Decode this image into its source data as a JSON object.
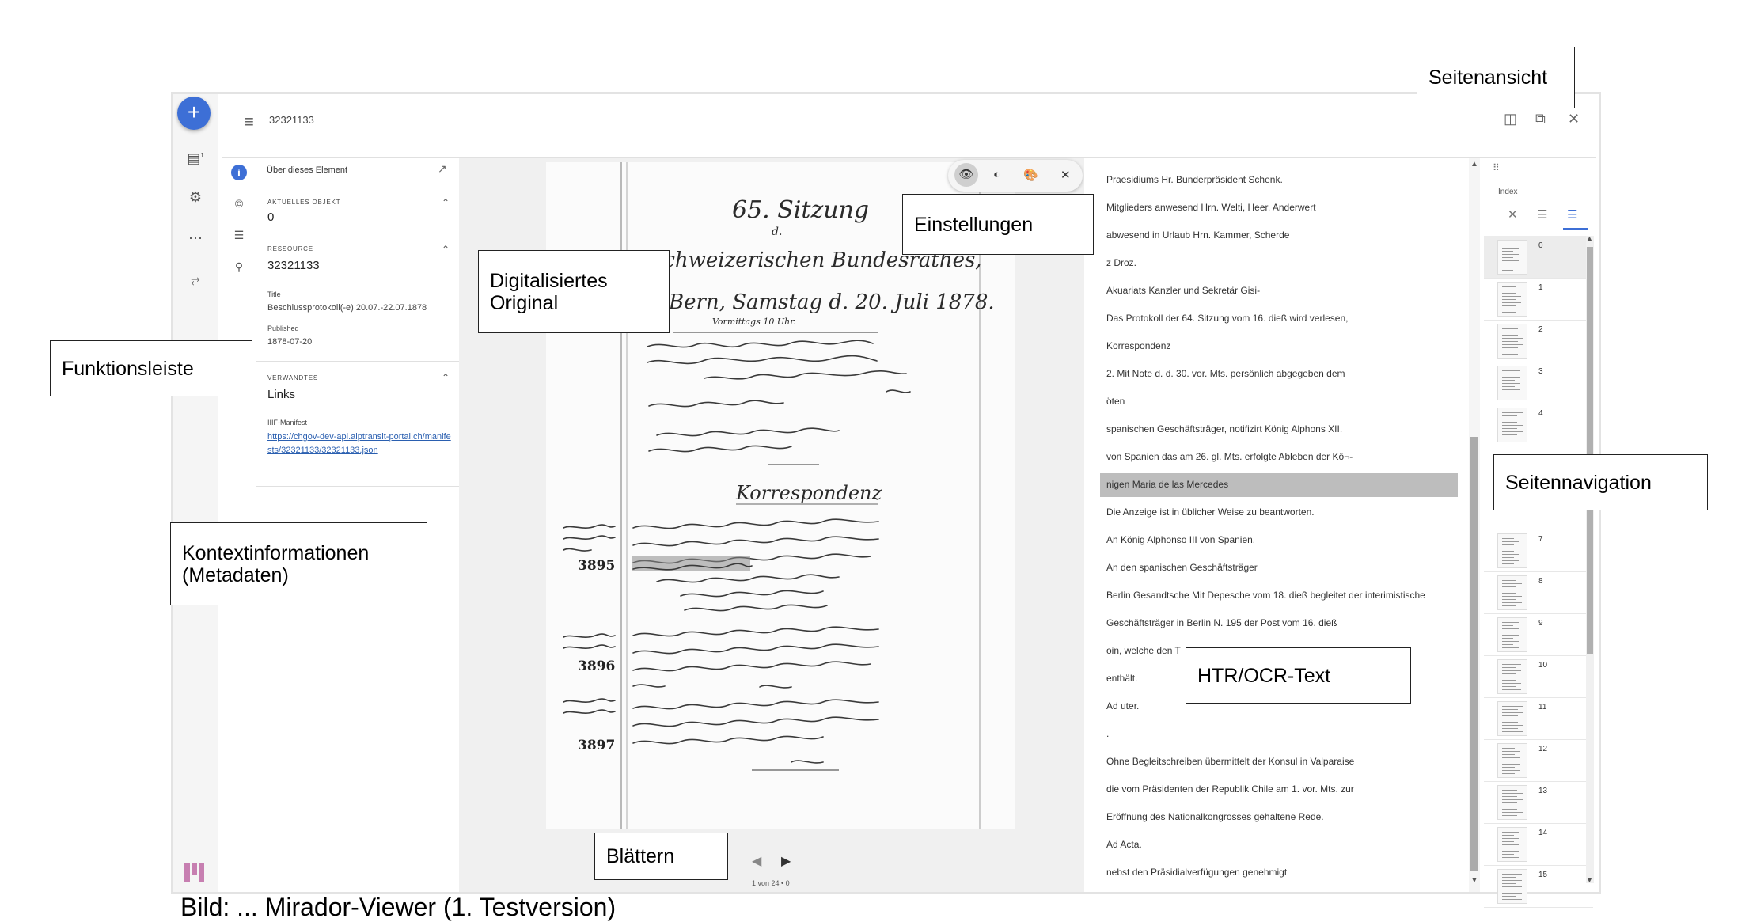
{
  "topbar": {
    "object_id": "32321133",
    "menu_icon": "hamburger-icon",
    "right_icons": [
      "split-view-icon",
      "fullscreen-icon",
      "close-icon"
    ],
    "close_glyph": "✕"
  },
  "leftbar": {
    "add_glyph": "+",
    "icons": [
      "catalog-icon",
      "settings-icon",
      "more-icon",
      "drag-icon"
    ],
    "catalog_badge": "1"
  },
  "sidenav": {
    "icons": [
      "info-icon",
      "copyright-icon",
      "toc-icon",
      "search-icon"
    ]
  },
  "metadata": {
    "header": "Über dieses Element",
    "current_object_caption": "AKTUELLES OBJEKT",
    "current_object_value": "0",
    "resource_caption": "RESSOURCE",
    "resource_value": "32321133",
    "title_caption": "Title",
    "title_value": "Beschlussprotokoll(-e) 20.07.-22.07.1878",
    "published_caption": "Published",
    "published_value": "1878-07-20",
    "related_caption": "VERWANDTES",
    "related_value": "Links",
    "iiif_caption": "IIIF-Manifest",
    "iiif_link": "https://chgov-dev-api.alptransit-portal.ch/manifests/32321133/32321133.json"
  },
  "viewer": {
    "tools": [
      "eye-icon",
      "contrast-icon",
      "palette-icon",
      "close-icon"
    ],
    "page_label": "1 von 24 • 0",
    "doc": {
      "title_line1": "65. Sitzung",
      "title_line2": "d.",
      "title_line3": "schweizerischen Bundesrathes,",
      "title_line4": "Bern, Samstag d. 20. Juli 1878.",
      "title_line5": "Vormittags 10 Uhr.",
      "heading": "Korrespondenz",
      "num1": "3895",
      "num2": "3896",
      "num3": "3897"
    }
  },
  "text_lines": [
    "Praesidiums Hr. Bunderpräsident Schenk.",
    "Mitglieders anwesend Hrn. Welti, Heer, Anderwert",
    "abwesend in Urlaub Hrn. Kammer, Scherde",
    "z Droz.",
    "Akuariats Kanzler und Sekretär Gisi-",
    "Das Protokoll der 64. Sitzung vom 16. dieß wird verlesen,",
    "Korrespondenz",
    "2. Mit Note d. d. 30. vor. Mts. persönlich abgegeben dem",
    "öten",
    "spanischen Geschäftsträger, notifizirt König Alphons XII.",
    "von Spanien das am 26. gl. Mts. erfolgte Ableben der Kö¬-",
    "nigen Maria de las Mercedes",
    "Die Anzeige ist in üblicher Weise zu beantworten.",
    "An König Alphonso III von Spanien.",
    "An den spanischen Geschäftsträger",
    "Berlin Gesandtsche Mit Depesche vom 18. dieß begleitet der interimistische",
    "Geschäftsträger in Berlin N. 195 der Post vom 16. dieß",
    "oin, welche den T",
    "enthält.",
    "Ad uter.",
    ".",
    "Ohne Begleitschreiben übermittelt der Konsul in Valparaise",
    "die vom Präsidenten der Republik Chile am 1. vor. Mts. zur",
    "Eröffnung des Nationalkongrosses gehaltene Rede.",
    "Ad Acta.",
    "nebst den Präsidialverfügungen genehmigt"
  ],
  "pagenav": {
    "label": "Index",
    "tabs": [
      "close-icon",
      "list-icon",
      "thumbnail-list-icon"
    ],
    "pages": [
      "0",
      "1",
      "2",
      "3",
      "4",
      "7",
      "8",
      "9",
      "10",
      "11",
      "12",
      "13",
      "14",
      "15"
    ]
  },
  "annotations": {
    "seitenansicht": "Seitenansicht",
    "einstellungen": "Einstellungen",
    "digitalisiertes": "Digitalisiertes Original",
    "funktionsleiste": "Funktionsleiste",
    "kontext": "Kontextinformationen (Metadaten)",
    "seitennavigation": "Seitennavigation",
    "htr": "HTR/OCR-Text",
    "blaettern": "Blättern"
  },
  "caption_cut": "Bild: ... Mirador-Viewer (1. Testversion)"
}
